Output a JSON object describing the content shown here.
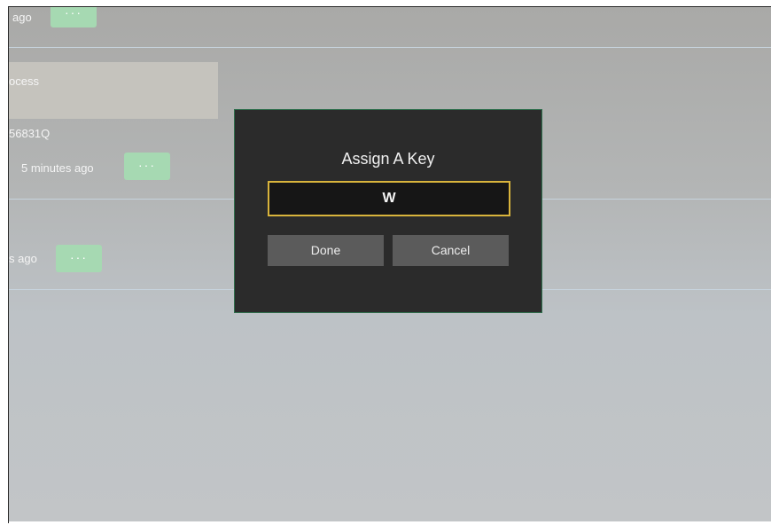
{
  "background": {
    "row1": {
      "time_text": "ago",
      "more_label": "···"
    },
    "row2": {
      "process_text": "ocess",
      "id_text": "56831Q",
      "time_text": "5 minutes ago",
      "more_label": "···"
    },
    "row3": {
      "time_text": "s ago",
      "more_label": "···"
    }
  },
  "dialog": {
    "title": "Assign A Key",
    "key_value": "W",
    "done_label": "Done",
    "cancel_label": "Cancel"
  },
  "colors": {
    "dialog_bg": "#2b2b2b",
    "dialog_border": "#2f6e4c",
    "input_border": "#d9b43c",
    "button_bg": "#5b5b5b",
    "more_button_bg": "#a6d9b2"
  }
}
